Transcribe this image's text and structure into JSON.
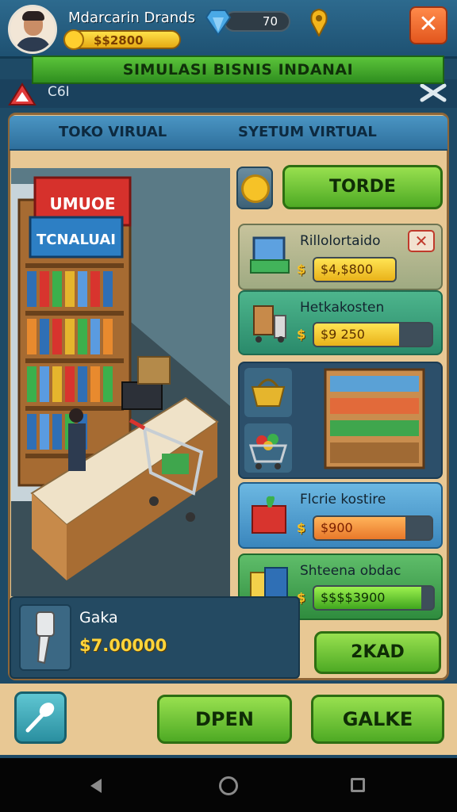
{
  "player": {
    "name": "Mdarcarin Drands",
    "money": "$$2800",
    "gems": "70",
    "gem_level": 0.0
  },
  "banner_title": "SIMULASI BISNIS INDANAI",
  "subbar_label": "C6I",
  "tabs": [
    {
      "label": "TOKO VIRUAL"
    },
    {
      "label": "SYETUM VIRTUAL"
    }
  ],
  "scene_signs": {
    "top": "UMUOE",
    "bottom": "TCNALUAI"
  },
  "trade_button": "TORDE",
  "items": [
    {
      "name": "Rillolortaido",
      "price": "$4,$800",
      "fill": 1.0
    },
    {
      "name": "Hetkakosten",
      "price": "$9 250",
      "fill": 0.72
    },
    {
      "name": "Flcrie kostire",
      "price": "$900",
      "fill": 0.78
    },
    {
      "name": "Shteena obdac",
      "price": "$$$$3900",
      "fill": 0.9
    }
  ],
  "add_button": "2KAD",
  "info": {
    "title": "Gaka",
    "price": "$7.00000"
  },
  "bottom_buttons": {
    "open": "DPEN",
    "trade": "GALKE"
  },
  "icons": [
    "gem-icon",
    "pin-icon",
    "close-icon",
    "coin-icon",
    "scanner-icon",
    "spoon-icon",
    "back-icon",
    "home-icon",
    "recent-apps-icon"
  ]
}
